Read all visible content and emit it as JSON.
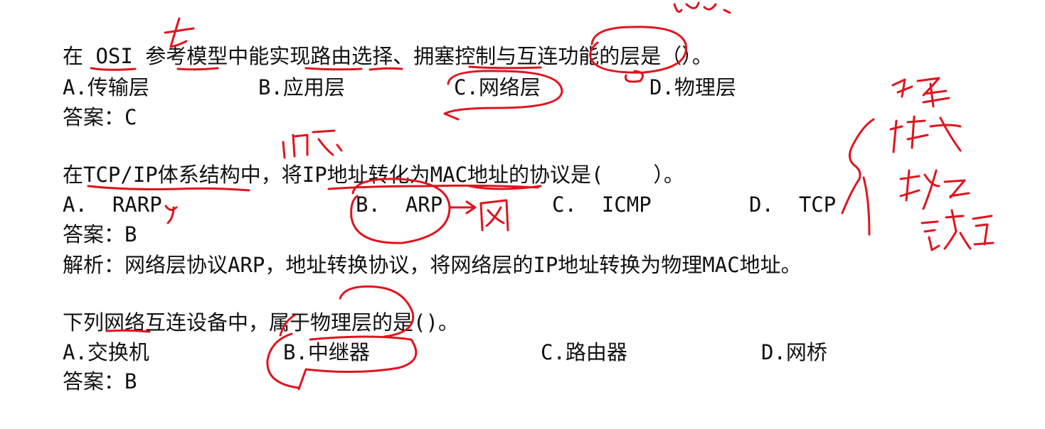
{
  "questions": [
    {
      "stem": "在 OSI 参考模型中能实现路由选择、拥塞控制与互连功能的层是（）。",
      "options": [
        "A.传输层",
        "B.应用层",
        "C.网络层",
        "D.物理层"
      ],
      "answer": "答案：C"
    },
    {
      "stem": "在TCP/IP体系结构中，将IP地址转化为MAC地址的协议是(    ）。",
      "options": [
        "A.  RARP",
        "B.  ARP",
        "C.  ICMP",
        "D.  TCP"
      ],
      "answer": "答案：B",
      "analysis": "解析：网络层协议ARP，地址转换协议，将网络层的IP地址转换为物理MAC地址。"
    },
    {
      "stem": "下列网络互连设备中，属于物理层的是()。",
      "options": [
        "A.交换机",
        "B.中继器",
        "C.路由器",
        "D.网桥"
      ],
      "answer": "答案：B"
    }
  ],
  "annotation_color": "#e0141e"
}
